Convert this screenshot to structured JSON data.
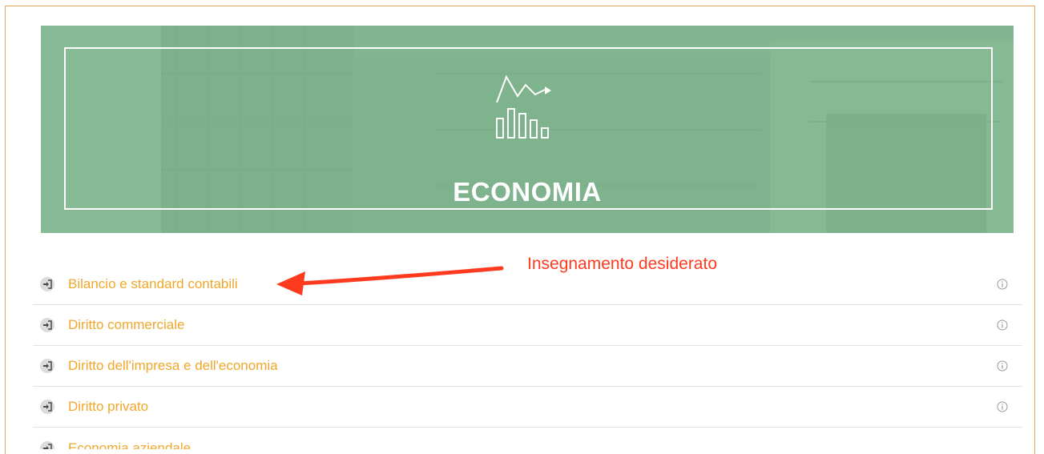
{
  "banner": {
    "title": "ECONOMIA",
    "icon": "economy-chart-icon"
  },
  "annotation": {
    "text": "Insegnamento desiderato",
    "color": "#ff3b1f"
  },
  "courses": [
    {
      "label": "Bilancio e standard contabili",
      "enter_icon": "enter-icon",
      "info_icon": "info-icon"
    },
    {
      "label": "Diritto commerciale",
      "enter_icon": "enter-icon",
      "info_icon": "info-icon"
    },
    {
      "label": "Diritto dell'impresa e dell'economia",
      "enter_icon": "enter-icon",
      "info_icon": "info-icon"
    },
    {
      "label": "Diritto privato",
      "enter_icon": "enter-icon",
      "info_icon": "info-icon"
    },
    {
      "label": "Economia aziendale",
      "enter_icon": "enter-icon",
      "info_icon": "info-icon"
    }
  ],
  "colors": {
    "link": "#f0a72a",
    "banner_tint": "#7ab68a",
    "frame_border": "#e8a45b"
  }
}
